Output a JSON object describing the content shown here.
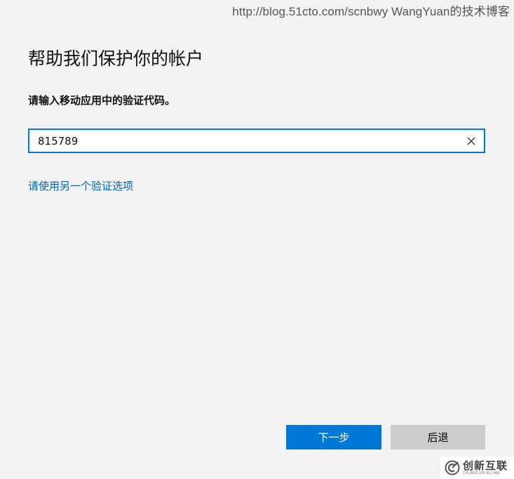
{
  "watermark": {
    "text": "http://blog.51cto.com/scnbwy WangYuan的技术博客"
  },
  "dialog": {
    "title": "帮助我们保护你的帐户",
    "instruction": "请输入移动应用中的验证代码。",
    "code_input": {
      "value": "815789",
      "clear_icon": "close-icon"
    },
    "alt_option_link": "请使用另一个验证选项",
    "buttons": {
      "next_label": "下一步",
      "back_label": "后退"
    }
  },
  "brand": {
    "name": "创新互联",
    "subtitle": "CHUANG XIN HU LIAN",
    "logo_icon": "brand-logo-icon"
  },
  "colors": {
    "background": "#f2f2f2",
    "accent": "#0078d7",
    "link": "#0063b1",
    "secondary_button": "#cccccc"
  }
}
